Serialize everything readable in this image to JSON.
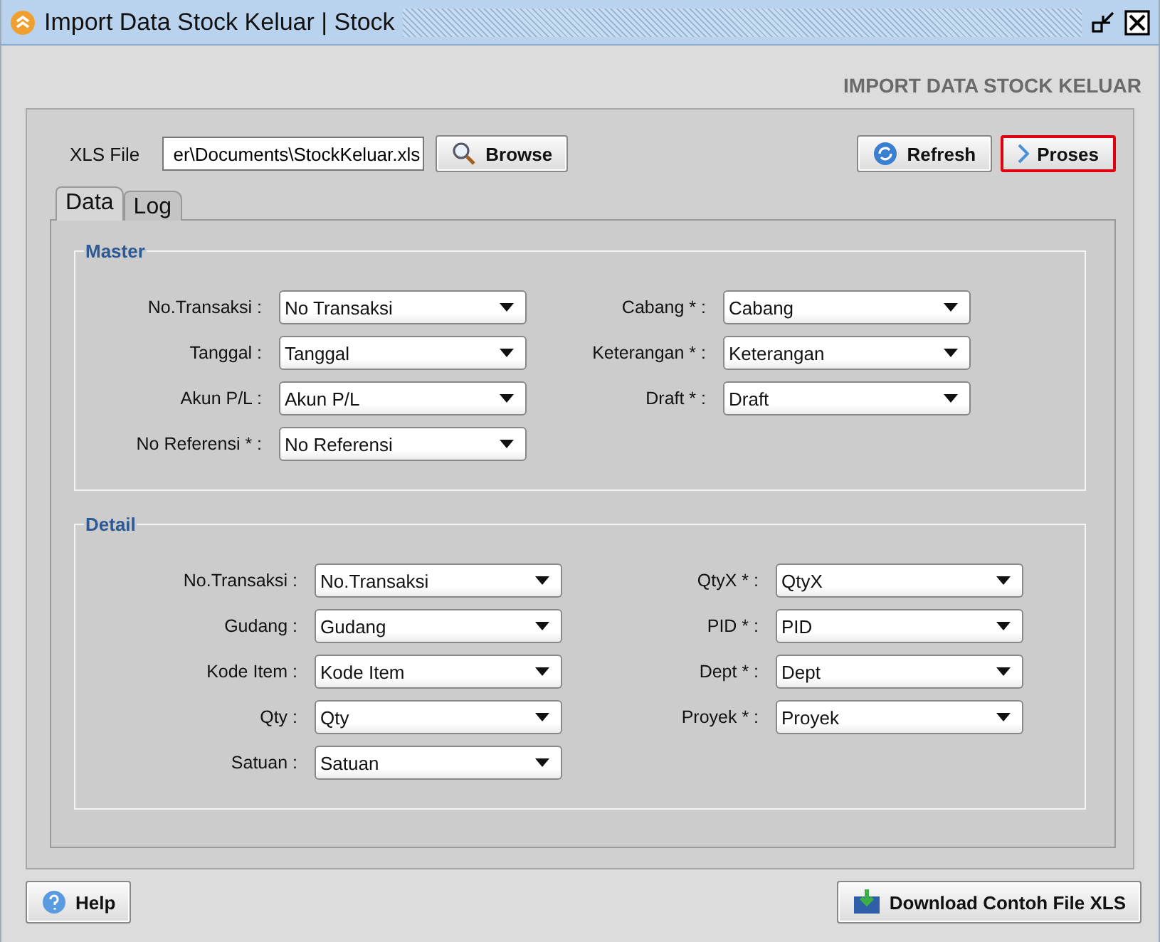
{
  "window": {
    "title": "Import Data Stock Keluar | Stock"
  },
  "heading": "IMPORT DATA STOCK KELUAR",
  "file": {
    "label": "XLS File",
    "value": "er\\Documents\\StockKeluar.xls"
  },
  "toolbar": [
    {
      "kind": "browse",
      "label": "Browse",
      "focused": false
    },
    {
      "kind": "refresh",
      "label": "Refresh",
      "focused": false
    },
    {
      "kind": "proses",
      "label": "Proses",
      "focused": true
    }
  ],
  "tabs": [
    {
      "label": "Data",
      "selected": true
    },
    {
      "label": "Log",
      "selected": false
    }
  ],
  "sections": [
    {
      "title": "Master",
      "left": [
        {
          "label": "No.Transaksi :",
          "value": "No Transaksi"
        },
        {
          "label": "Tanggal :",
          "value": "Tanggal"
        },
        {
          "label": "Akun P/L :",
          "value": "Akun P/L"
        },
        {
          "label": "No Referensi * :",
          "value": "No Referensi"
        }
      ],
      "right": [
        {
          "label": "Cabang * :",
          "value": "Cabang"
        },
        {
          "label": "Keterangan * :",
          "value": "Keterangan"
        },
        {
          "label": "Draft * :",
          "value": "Draft"
        }
      ]
    },
    {
      "title": "Detail",
      "left": [
        {
          "label": "No.Transaksi :",
          "value": "No.Transaksi"
        },
        {
          "label": "Gudang :",
          "value": "Gudang"
        },
        {
          "label": "Kode Item :",
          "value": "Kode Item"
        },
        {
          "label": "Qty :",
          "value": "Qty"
        },
        {
          "label": "Satuan :",
          "value": "Satuan"
        }
      ],
      "right": [
        {
          "label": "QtyX * :",
          "value": "QtyX"
        },
        {
          "label": "PID * :",
          "value": "PID"
        },
        {
          "label": "Dept * :",
          "value": "Dept"
        },
        {
          "label": "Proyek * :",
          "value": "Proyek"
        }
      ]
    }
  ],
  "footer": [
    {
      "kind": "help",
      "label": "Help",
      "focused": false
    },
    {
      "kind": "download",
      "label": "Download Contoh File XLS",
      "focused": false
    }
  ]
}
